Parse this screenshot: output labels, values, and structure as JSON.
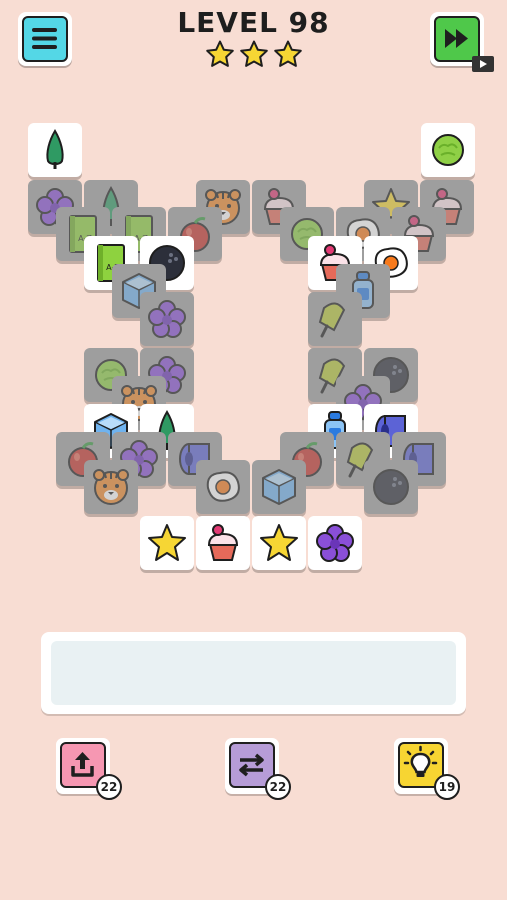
{
  "header": {
    "level_label": "LEVEL 98",
    "stars_earned": 3,
    "stars_total": 3,
    "menu_icon": "hamburger-menu-icon",
    "skip_icon": "fast-forward-icon"
  },
  "board": {
    "tiles": [
      {
        "item": "tree",
        "state": "free"
      },
      {
        "item": "cabbage",
        "state": "free"
      },
      {
        "item": "flower",
        "state": "blocked"
      },
      {
        "item": "tree",
        "state": "blocked"
      },
      {
        "item": "tiger",
        "state": "blocked"
      },
      {
        "item": "cupcake",
        "state": "blocked"
      },
      {
        "item": "star",
        "state": "blocked"
      },
      {
        "item": "cupcake",
        "state": "blocked"
      },
      {
        "item": "book",
        "state": "blocked"
      },
      {
        "item": "book",
        "state": "blocked"
      },
      {
        "item": "apple",
        "state": "blocked"
      },
      {
        "item": "cabbage",
        "state": "blocked"
      },
      {
        "item": "egg",
        "state": "blocked"
      },
      {
        "item": "cupcake",
        "state": "blocked"
      },
      {
        "item": "book",
        "state": "free"
      },
      {
        "item": "ball",
        "state": "free"
      },
      {
        "item": "cupcake",
        "state": "free"
      },
      {
        "item": "egg",
        "state": "free"
      },
      {
        "item": "ice-cube",
        "state": "blocked"
      },
      {
        "item": "bottle",
        "state": "blocked"
      },
      {
        "item": "flower",
        "state": "blocked"
      },
      {
        "item": "popsicle",
        "state": "blocked"
      },
      {
        "item": "cabbage",
        "state": "blocked"
      },
      {
        "item": "flower",
        "state": "blocked"
      },
      {
        "item": "popsicle",
        "state": "blocked"
      },
      {
        "item": "ball",
        "state": "blocked"
      },
      {
        "item": "tiger",
        "state": "blocked"
      },
      {
        "item": "flower",
        "state": "blocked"
      },
      {
        "item": "ice-cube",
        "state": "free"
      },
      {
        "item": "tree",
        "state": "free"
      },
      {
        "item": "bottle",
        "state": "free"
      },
      {
        "item": "toilet-paper",
        "state": "free"
      },
      {
        "item": "apple",
        "state": "blocked"
      },
      {
        "item": "flower",
        "state": "blocked"
      },
      {
        "item": "toilet-paper",
        "state": "blocked"
      },
      {
        "item": "apple",
        "state": "blocked"
      },
      {
        "item": "popsicle",
        "state": "blocked"
      },
      {
        "item": "toilet-paper",
        "state": "blocked"
      },
      {
        "item": "tiger",
        "state": "blocked"
      },
      {
        "item": "egg",
        "state": "blocked"
      },
      {
        "item": "ice-cube",
        "state": "blocked"
      },
      {
        "item": "ball",
        "state": "blocked"
      },
      {
        "item": "star",
        "state": "free"
      },
      {
        "item": "cupcake",
        "state": "free"
      },
      {
        "item": "star",
        "state": "free"
      },
      {
        "item": "flower",
        "state": "free"
      }
    ]
  },
  "tray": {
    "slots_filled": 0
  },
  "powerups": {
    "undo": {
      "icon": "undo-arrow-icon",
      "count": "22",
      "color": "#f697b2"
    },
    "shuffle": {
      "icon": "shuffle-icon",
      "count": "22",
      "color": "#b69cd7"
    },
    "hint": {
      "icon": "lightbulb-icon",
      "count": "19",
      "color": "#f7d532"
    }
  },
  "colors": {
    "background": "#f8ddd3",
    "menu_button": "#54d7e6",
    "skip_button": "#4fc84a",
    "star": "#f6d634"
  }
}
